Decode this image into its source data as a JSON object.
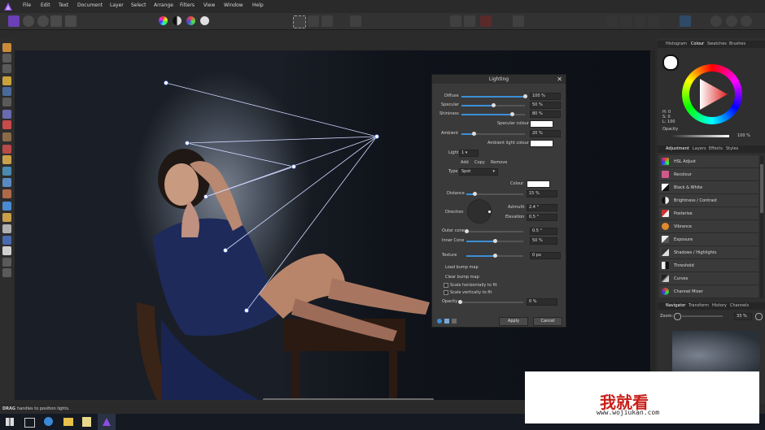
{
  "menubar": {
    "items": [
      "File",
      "Edit",
      "Text",
      "Document",
      "Layer",
      "Select",
      "Arrange",
      "Filters",
      "View",
      "Window",
      "Help"
    ]
  },
  "status": {
    "bold": "DRAG",
    "text": "handles to position lights."
  },
  "dialog": {
    "title": "Lighting",
    "diffuse": {
      "label": "Diffuse",
      "value": "100 %",
      "level": 1.0
    },
    "specular": {
      "label": "Specular",
      "value": "50 %",
      "level": 0.5
    },
    "shininess": {
      "label": "Shininess",
      "value": "80 %",
      "level": 0.8
    },
    "specular_colour": "Specular colour",
    "ambient": {
      "label": "Ambient",
      "value": "20 %",
      "level": 0.2
    },
    "ambient_light_colour": "Ambient light colour",
    "light_label": "Light",
    "light_value": "1",
    "add": "Add",
    "copy": "Copy",
    "remove": "Remove",
    "type_label": "Type",
    "type_value": "Spot",
    "colour_label": "Colour",
    "distance": {
      "label": "Distance",
      "value": "15 %",
      "level": 0.15
    },
    "direction_label": "Direction",
    "azimuth": {
      "label": "Azimuth",
      "value": "2.4 °"
    },
    "elevation": {
      "label": "Elevation",
      "value": "0.5 °"
    },
    "outer_cone": {
      "label": "Outer cone",
      "value": "0.5 °",
      "level": 0.0
    },
    "inner_cone": {
      "label": "Inner Cone",
      "value": "50 %",
      "level": 0.5
    },
    "texture": {
      "label": "Texture",
      "value": "0 px",
      "level": 0.5
    },
    "load_bump": "Load bump map",
    "clear_bump": "Clear bump map",
    "scale_h": "Scale horizontally to fit",
    "scale_v": "Scale vertically to fit",
    "opacity": {
      "label": "Opacity",
      "value": "0 %",
      "level": 0.0
    },
    "apply": "Apply",
    "cancel": "Cancel"
  },
  "right": {
    "top_tabs": [
      "Histogram",
      "Colour",
      "Swatches",
      "Brushes"
    ],
    "hsl": {
      "h": "H: 0",
      "s": "S: 0",
      "l": "L: 100"
    },
    "opacity_label": "Opacity",
    "opacity_value": "100 %",
    "adj_tabs": [
      "Adjustment",
      "Layers",
      "Effects",
      "Styles"
    ],
    "adjustments": [
      "HSL Adjust",
      "Recolour",
      "Black & White",
      "Brightness / Contrast",
      "Posterise",
      "Vibrance",
      "Exposure",
      "Shadows / Highlights",
      "Threshold",
      "Curves",
      "Channel Mixer"
    ],
    "nav_tabs": [
      "Navigator",
      "Transform",
      "History",
      "Channels"
    ],
    "zoom_label": "Zoom:",
    "zoom_value": "33 %"
  },
  "watermark": {
    "cn": "我就看",
    "url": "www.wojiukan.com"
  },
  "colors": {
    "accent": "#3b8fd6",
    "affinity_purple": "#7f4bd6"
  }
}
